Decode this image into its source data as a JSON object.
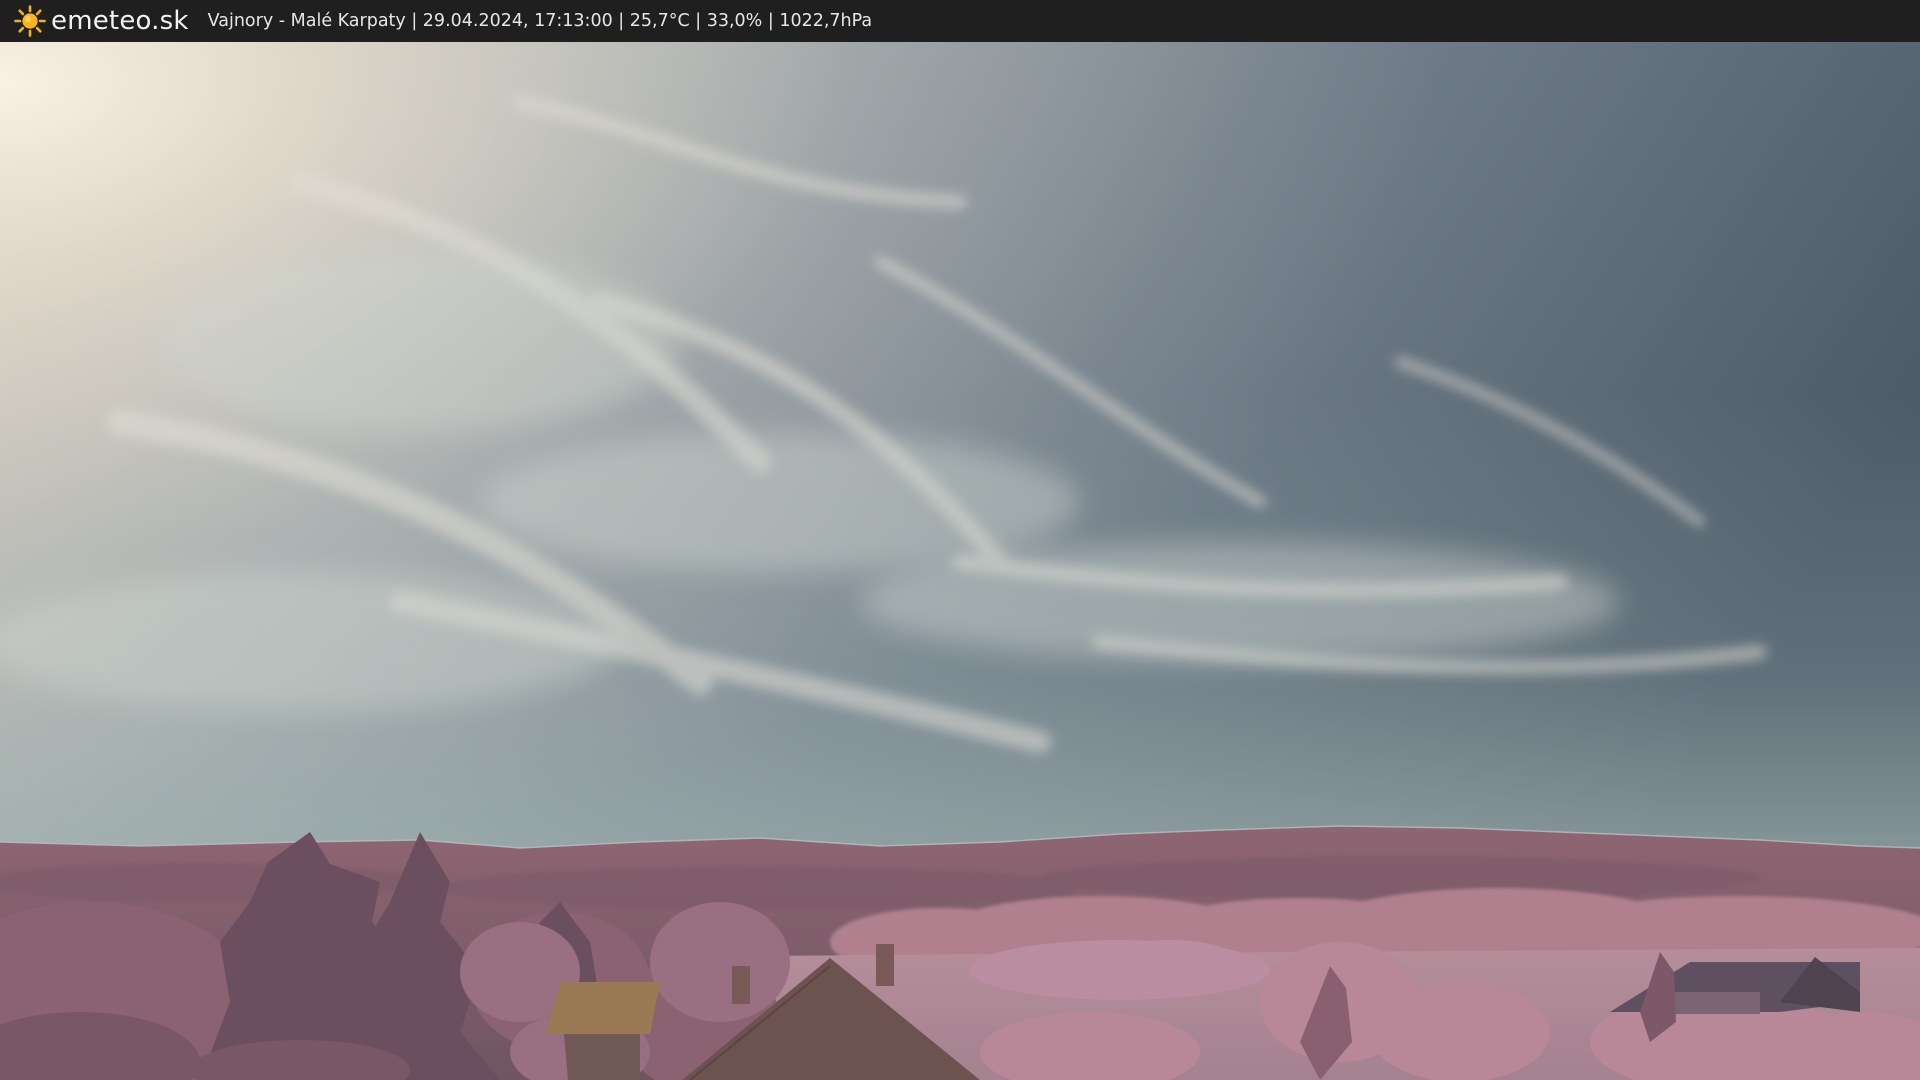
{
  "header": {
    "brand": "emeteo.sk",
    "logo_icon": "sun-icon",
    "caption": "Vajnory - Malé Karpaty | 29.04.2024, 17:13:00 | 25,7°C | 33,0% | 1022,7hPa"
  },
  "colors": {
    "bar_background": "#1f1f1f",
    "sun": "#f5b21b",
    "sky_light": "#e6dccd",
    "sky_dark": "#4d5d6b",
    "vegetation": "#8a5f72"
  }
}
